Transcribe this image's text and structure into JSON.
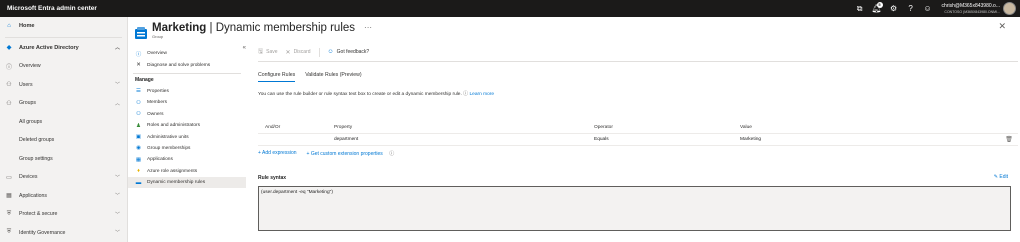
{
  "topbar": {
    "app_title": "Microsoft Entra admin center",
    "notification_count": "5",
    "account_user": "chrish@M365x843980.o...",
    "account_org": "CONTOSO (M365X843980.ONMI..."
  },
  "leftnav": {
    "items": [
      {
        "label": "Home",
        "icon": "⌂"
      },
      {
        "label": "Azure Active Directory",
        "icon": "◆"
      },
      {
        "label": "Overview",
        "icon": "ⓘ"
      },
      {
        "label": "Users",
        "icon": "⚇"
      },
      {
        "label": "Groups",
        "icon": "⚇"
      },
      {
        "label": "All groups"
      },
      {
        "label": "Deleted groups"
      },
      {
        "label": "Group settings"
      },
      {
        "label": "Devices",
        "icon": "▭"
      },
      {
        "label": "Applications",
        "icon": "▦"
      },
      {
        "label": "Protect & secure",
        "icon": "⛨"
      },
      {
        "label": "Identity Governance",
        "icon": "⛨"
      }
    ]
  },
  "header": {
    "title_bold": "Marketing",
    "title_rest": " | Dynamic membership rules",
    "subtitle": "Group",
    "more": "···"
  },
  "bladenav": {
    "top_items": [
      {
        "label": "Overview",
        "icon": "ⓘ"
      },
      {
        "label": "Diagnose and solve problems",
        "icon": "✕"
      }
    ],
    "manage_heading": "Manage",
    "manage_items": [
      {
        "label": "Properties",
        "icon": "☰"
      },
      {
        "label": "Members",
        "icon": "⚇"
      },
      {
        "label": "Owners",
        "icon": "⚇"
      },
      {
        "label": "Roles and administrators",
        "icon": "♟"
      },
      {
        "label": "Administrative units",
        "icon": "▣"
      },
      {
        "label": "Group memberships",
        "icon": "◉"
      },
      {
        "label": "Applications",
        "icon": "▦"
      },
      {
        "label": "Azure role assignments",
        "icon": "♦"
      },
      {
        "label": "Dynamic membership rules",
        "icon": "▬"
      }
    ]
  },
  "cmdbar": {
    "save": "Save",
    "discard": "Discard",
    "feedback": "Got feedback?"
  },
  "tabs": {
    "configure": "Configure Rules",
    "validate": "Validate Rules (Preview)"
  },
  "description": {
    "text": "You can use the rule builder or rule syntax text box to create or edit a dynamic membership rule.",
    "link": "Learn more"
  },
  "rules_table": {
    "headers": [
      "And/Or",
      "Property",
      "Operator",
      "Value"
    ],
    "rows": [
      {
        "and_or": "",
        "property": "department",
        "operator": "Equals",
        "value": "Marketing"
      }
    ]
  },
  "actions": {
    "add_expression": "Add expression",
    "custom_props": "Get custom extension properties"
  },
  "syntax": {
    "label": "Rule syntax",
    "edit": "Edit",
    "value": "(user.department -eq \"Marketing\")"
  },
  "colors": {
    "accent": "#0078d4",
    "topbar_bg": "#1b1a19"
  }
}
